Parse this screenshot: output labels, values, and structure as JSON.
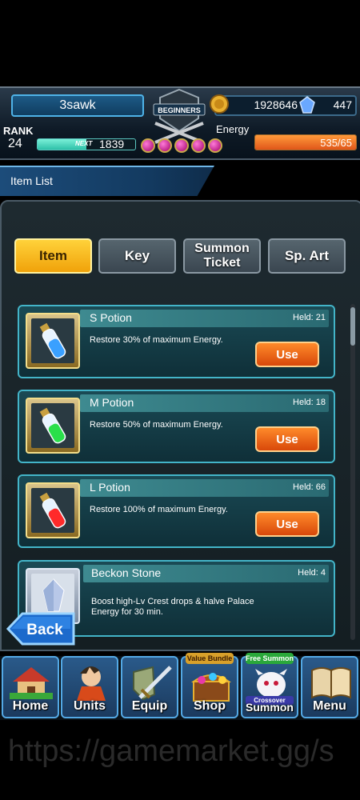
{
  "header": {
    "player_name": "3sawk",
    "emblem_text": "BEGINNERS",
    "gold": "1928646",
    "gems": "447",
    "rank_label": "RANK",
    "rank": "24",
    "next_label": "NEXT",
    "next_exp": "1839",
    "exp_progress": 0.5,
    "energy_label": "Energy",
    "energy": "535/65",
    "energy_progress": 1.0
  },
  "title_bar": {
    "label": "Item List"
  },
  "tabs": [
    {
      "label": "Item",
      "active": true
    },
    {
      "label": "Key",
      "active": false
    },
    {
      "label": "Summon Ticket",
      "active": false
    },
    {
      "label": "Sp. Art",
      "active": false
    }
  ],
  "items": [
    {
      "name": "S Potion",
      "held": "Held: 21",
      "desc": "Restore 30% of maximum Energy.",
      "use_label": "Use",
      "icon": "blue-potion-icon",
      "color": "#3aa0ff"
    },
    {
      "name": "M Potion",
      "held": "Held: 18",
      "desc": "Restore 50% of maximum Energy.",
      "use_label": "Use",
      "icon": "green-potion-icon",
      "color": "#2adf4a"
    },
    {
      "name": "L Potion",
      "held": "Held: 66",
      "desc": "Restore 100% of maximum Energy.",
      "use_label": "Use",
      "icon": "red-potion-icon",
      "color": "#ff2a2a"
    },
    {
      "name": "Beckon Stone",
      "held": "Held: 4",
      "desc": "Boost high-Lv Crest drops & halve Palace Energy for 30 min.",
      "icon": "crystal-stone-icon",
      "color": "#b8c8e8"
    }
  ],
  "back_button": {
    "label": "Back"
  },
  "nav": [
    {
      "label": "Home",
      "icon": "house-icon"
    },
    {
      "label": "Units",
      "icon": "hero-icon"
    },
    {
      "label": "Equip",
      "icon": "sword-shield-icon"
    },
    {
      "label": "Shop",
      "icon": "treasure-chest-icon",
      "badge": "Value Bundle"
    },
    {
      "label": "Summon",
      "icon": "summon-creature-icon",
      "badge": "Free Summon",
      "sub_badge": "Crossover"
    },
    {
      "label": "Menu",
      "icon": "book-icon"
    }
  ],
  "watermark": "https://gamemarket.gg/s"
}
